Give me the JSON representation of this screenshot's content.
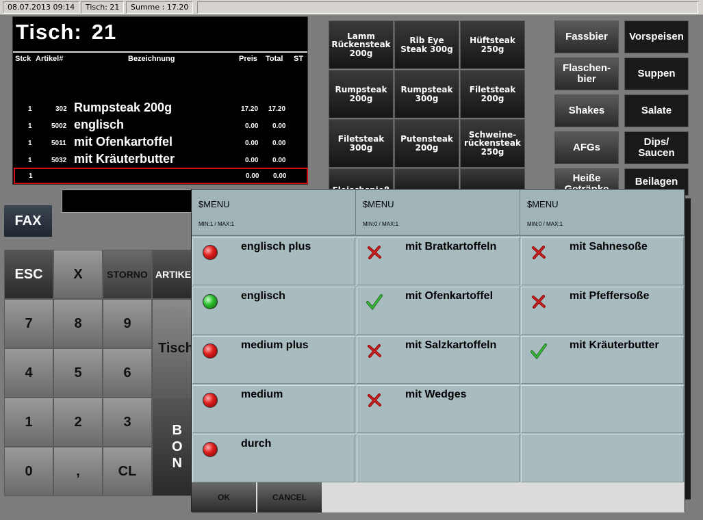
{
  "status_bar": {
    "datetime": "08.07.2013 09:14",
    "table": "Tisch:  21",
    "sum": "Summe : 17.20"
  },
  "receipt": {
    "title_label": "Tisch:",
    "table_number": "21",
    "headers": {
      "qty": "Stck",
      "article": "Artikel#",
      "name": "Bezeichnung",
      "price": "Preis",
      "total": "Total",
      "st": "ST"
    },
    "rows": [
      {
        "qty": "1",
        "article": "302",
        "name": "Rumpsteak 200g",
        "price": "17.20",
        "total": "17.20"
      },
      {
        "qty": "1",
        "article": "5002",
        "name": "englisch",
        "price": "0.00",
        "total": "0.00"
      },
      {
        "qty": "1",
        "article": "5011",
        "name": "mit Ofenkartoffel",
        "price": "0.00",
        "total": "0.00"
      },
      {
        "qty": "1",
        "article": "5032",
        "name": "mit Kräuterbutter",
        "price": "0.00",
        "total": "0.00"
      },
      {
        "qty": "1",
        "article": "",
        "name": "",
        "price": "0.00",
        "total": "0.00"
      }
    ]
  },
  "menu_items": [
    "Lamm Rückensteak 200g",
    "Rib Eye Steak 300g",
    "Hüftsteak 250g",
    "Rumpsteak 200g",
    "Rumpsteak 300g",
    "Filetsteak 200g",
    "Filetsteak 300g",
    "Putensteak 200g",
    "Schweine-rückensteak 250g",
    "Fleischspieß"
  ],
  "categories": [
    "Fassbier",
    "Vorspeisen",
    "Flaschen-bier",
    "Suppen",
    "Shakes",
    "Salate",
    "AFGs",
    "Dips/ Saucen",
    "Heiße Getränke",
    "Beilagen"
  ],
  "keypad": {
    "fax": "FAX",
    "keys": [
      "ESC",
      "X",
      "STORNO",
      "ARTIKEL",
      "7",
      "8",
      "9",
      "4",
      "5",
      "6",
      "1",
      "2",
      "3",
      "0",
      ",",
      "CL"
    ],
    "tisch": "Tisch",
    "bon": "B O N"
  },
  "modal": {
    "columns": [
      {
        "title": "$MENU",
        "minmax": "MIN:1 / MAX:1",
        "options": [
          {
            "label": "englisch plus",
            "state": "red"
          },
          {
            "label": "englisch",
            "state": "green"
          },
          {
            "label": "medium plus",
            "state": "red"
          },
          {
            "label": "medium",
            "state": "red"
          },
          {
            "label": "durch",
            "state": "red"
          }
        ]
      },
      {
        "title": "$MENU",
        "minmax": "MIN:0 / MAX:1",
        "options": [
          {
            "label": "mit Bratkartoffeln",
            "state": "cross"
          },
          {
            "label": "mit Ofenkartoffel",
            "state": "check"
          },
          {
            "label": "mit Salzkartoffeln",
            "state": "cross"
          },
          {
            "label": "mit Wedges",
            "state": "cross"
          }
        ]
      },
      {
        "title": "$MENU",
        "minmax": "MIN:0 / MAX:1",
        "options": [
          {
            "label": "mit Sahnesoße",
            "state": "cross"
          },
          {
            "label": "mit Pfeffersoße",
            "state": "cross"
          },
          {
            "label": "mit Kräuterbutter",
            "state": "check"
          }
        ]
      }
    ],
    "ok_label": "OK",
    "cancel_label": "CANCEL"
  },
  "colors": {
    "accent_red": "#d01010",
    "modal_bg": "#a8bcc0",
    "cross": "#c01010",
    "check": "#2a9a2a"
  }
}
